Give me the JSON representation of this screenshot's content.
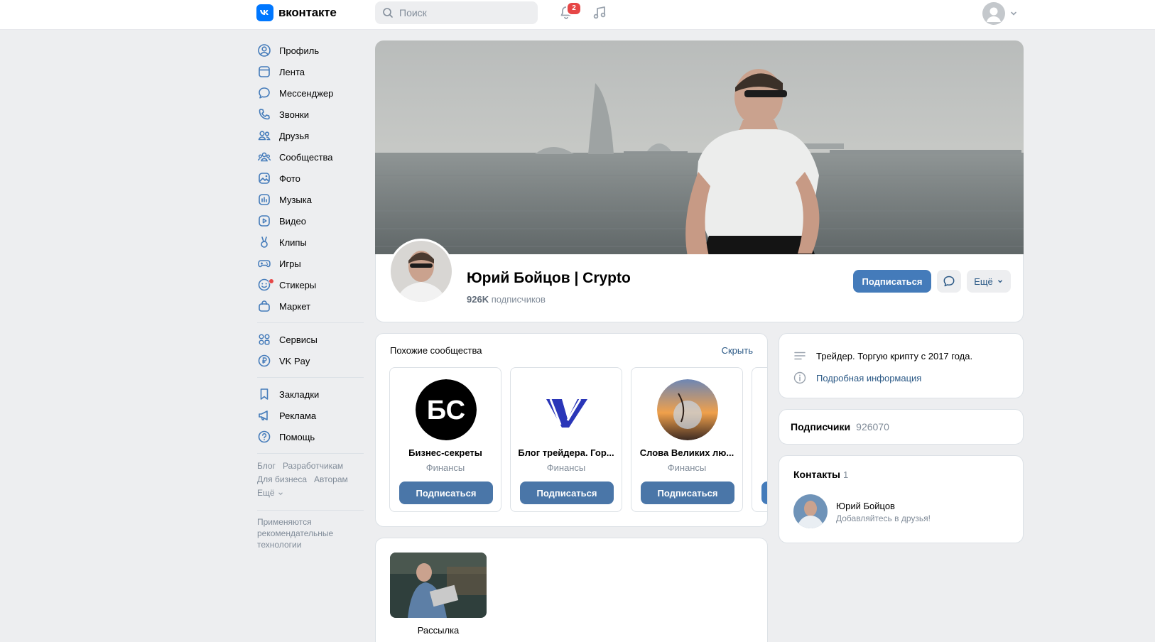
{
  "header": {
    "logo_text": "вконтакте",
    "search_placeholder": "Поиск",
    "notifications_count": "2"
  },
  "sidebar": {
    "items": [
      {
        "label": "Профиль",
        "icon": "profile-icon"
      },
      {
        "label": "Лента",
        "icon": "feed-icon"
      },
      {
        "label": "Мессенджер",
        "icon": "messenger-icon"
      },
      {
        "label": "Звонки",
        "icon": "phone-icon"
      },
      {
        "label": "Друзья",
        "icon": "friends-icon"
      },
      {
        "label": "Сообщества",
        "icon": "communities-icon"
      },
      {
        "label": "Фото",
        "icon": "photo-icon"
      },
      {
        "label": "Музыка",
        "icon": "music-icon"
      },
      {
        "label": "Видео",
        "icon": "video-icon"
      },
      {
        "label": "Клипы",
        "icon": "clips-icon"
      },
      {
        "label": "Игры",
        "icon": "games-icon"
      },
      {
        "label": "Стикеры",
        "icon": "stickers-icon"
      },
      {
        "label": "Маркет",
        "icon": "market-icon"
      }
    ],
    "items2": [
      {
        "label": "Сервисы",
        "icon": "services-icon"
      },
      {
        "label": "VK Pay",
        "icon": "vkpay-icon"
      }
    ],
    "items3": [
      {
        "label": "Закладки",
        "icon": "bookmark-icon"
      },
      {
        "label": "Реклама",
        "icon": "ads-icon"
      },
      {
        "label": "Помощь",
        "icon": "help-icon"
      }
    ],
    "footer": {
      "blog": "Блог",
      "developers": "Разработчикам",
      "business": "Для бизнеса",
      "authors": "Авторам",
      "more": "Ещё"
    },
    "recommendation_note": "Применяются рекомендательные технологии"
  },
  "profile": {
    "name": "Юрий Бойцов | Crypto",
    "subscribers_count": "926K",
    "subscribers_label": "подписчиков",
    "subscribe_label": "Подписаться",
    "more_label": "Ещё"
  },
  "similar": {
    "title": "Похожие сообщества",
    "hide_label": "Скрыть",
    "cards": [
      {
        "name": "Бизнес-секреты",
        "category": "Финансы",
        "button": "Подписаться",
        "logo_text": "БС"
      },
      {
        "name": "Блог трейдера. Гор...",
        "category": "Финансы",
        "button": "Подписаться"
      },
      {
        "name": "Слова Великих лю...",
        "category": "Финансы",
        "button": "Подписаться"
      }
    ]
  },
  "media": {
    "label": "Рассылка"
  },
  "info": {
    "description": "Трейдер. Торгую крипту с 2017 года.",
    "details_link": "Подробная информация"
  },
  "subscribers_block": {
    "title": "Подписчики",
    "count": "926070"
  },
  "contacts": {
    "title": "Контакты",
    "count": "1",
    "name": "Юрий Бойцов",
    "subtitle": "Добавляйтесь в друзья!"
  },
  "colors": {
    "accent": "#4a76a8",
    "link": "#2a5885",
    "background": "#edeef0",
    "badge": "#e64646"
  }
}
